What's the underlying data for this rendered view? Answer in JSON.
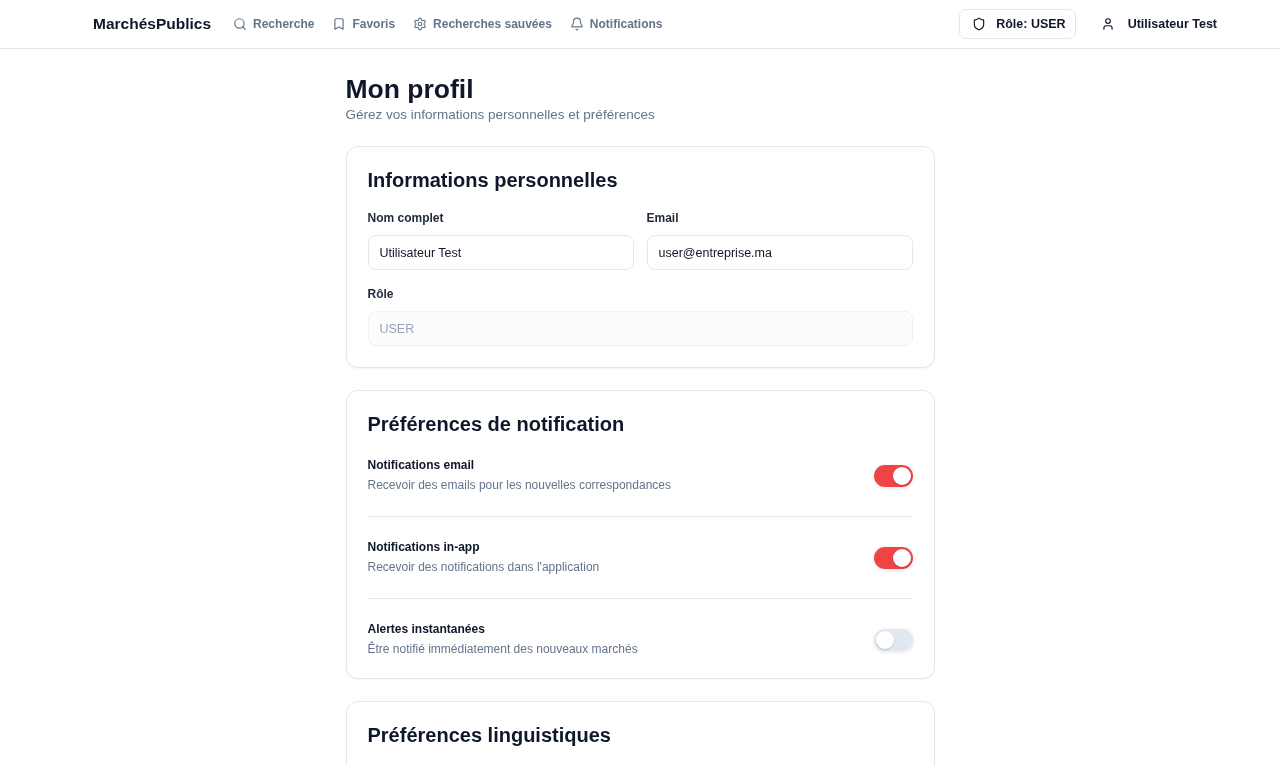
{
  "header": {
    "brand": "MarchésPublics",
    "nav": [
      {
        "label": "Recherche"
      },
      {
        "label": "Favoris"
      },
      {
        "label": "Recherches sauvées"
      },
      {
        "label": "Notifications"
      }
    ],
    "role_badge": "Rôle: USER",
    "user": "Utilisateur Test"
  },
  "page": {
    "title": "Mon profil",
    "subtitle": "Gérez vos informations personnelles et préférences"
  },
  "personal_info": {
    "title": "Informations personnelles",
    "rows": [
      [
        {
          "label": "Nom complet",
          "value": "Utilisateur Test",
          "disabled": false
        },
        {
          "label": "Email",
          "value": "user@entreprise.ma",
          "disabled": false
        }
      ],
      [
        {
          "label": "Rôle",
          "value": "USER",
          "disabled": true
        }
      ]
    ]
  },
  "notifications": {
    "title": "Préférences de notification",
    "items": [
      {
        "label": "Notifications email",
        "description": "Recevoir des emails pour les nouvelles correspondances",
        "on": true
      },
      {
        "label": "Notifications in-app",
        "description": "Recevoir des notifications dans l'application",
        "on": true
      },
      {
        "label": "Alertes instantanées",
        "description": "Être notifié immédiatement des nouveaux marchés",
        "on": false
      }
    ]
  },
  "language": {
    "title": "Préférences linguistiques"
  }
}
